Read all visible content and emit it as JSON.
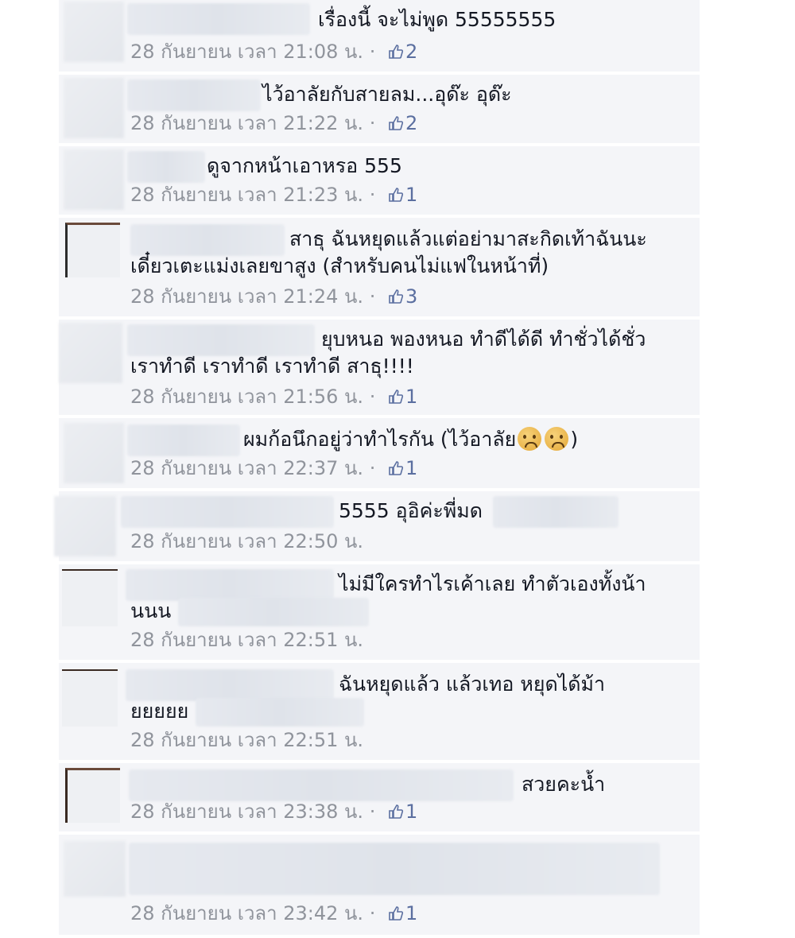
{
  "comments": [
    {
      "text": "เรื่องนี้      จะไม่พูด 55555555",
      "time": "28 กันยายน เวลา 21:08 น.",
      "likes": "2"
    },
    {
      "text": "ไว้อาลัยกับสายลม...อุด๊ะ อุด๊ะ",
      "time": "28 กันยายน เวลา 21:22 น.",
      "likes": "2"
    },
    {
      "text": "ดูจากหน้าเอาหรอ 555",
      "time": "28 กันยายน เวลา 21:23 น.",
      "likes": "1"
    },
    {
      "text": "สาธุ ฉันหยุดแล้วแต่อย่ามาสะกิดเท้าฉันนะ",
      "text2": "เดี๋ยวเตะแม่งเลยขาสูง (สำหรับคนไม่แฟในหน้าที่)",
      "time": "28 กันยายน เวลา 21:24 น.",
      "likes": "3"
    },
    {
      "text": "ยุบหนอ พองหนอ ทำดีได้ดี ทำชั่วได้ชั่ว",
      "text2": "เราทำดี เราทำดี เราทำดี สาธุ!!!!",
      "time": "28 กันยายน เวลา 21:56 น.",
      "likes": "1"
    },
    {
      "text": "ผมก้อนึกอยู่ว่าทำไรกัน (ไว้อาลัย",
      "text_end": ")",
      "time": "28 กันยายน เวลา 22:37 น.",
      "likes": "1"
    },
    {
      "text": "5555 อุอิค่ะพี่มด",
      "time": "28 กันยายน เวลา 22:50 น."
    },
    {
      "text": "ไม่มีใครทำไรเค้าเลย ทำตัวเองทั้งน้า",
      "text2": "นนน",
      "time": "28 กันยายน เวลา 22:51 น."
    },
    {
      "text": "ฉันหยุดแล้ว แล้วเทอ หยุดได้ม้า",
      "text2": "ยยยยย",
      "time": "28 กันยายน เวลา 22:51 น."
    },
    {
      "text": "สวยคะน้ำ",
      "time": "28 กันยายน เวลา 23:38 น.",
      "likes": "1"
    },
    {
      "time": "28 กันยายน เวลา 23:42 น.",
      "likes": "1"
    }
  ],
  "separator": "·",
  "colors": {
    "row_bg": "#f4f5f8",
    "text": "#141823",
    "meta": "#90949c",
    "like": "#5b6fa0"
  },
  "icons": {
    "like": "thumbs-up-icon",
    "emoji": "frowning-face-icon"
  }
}
